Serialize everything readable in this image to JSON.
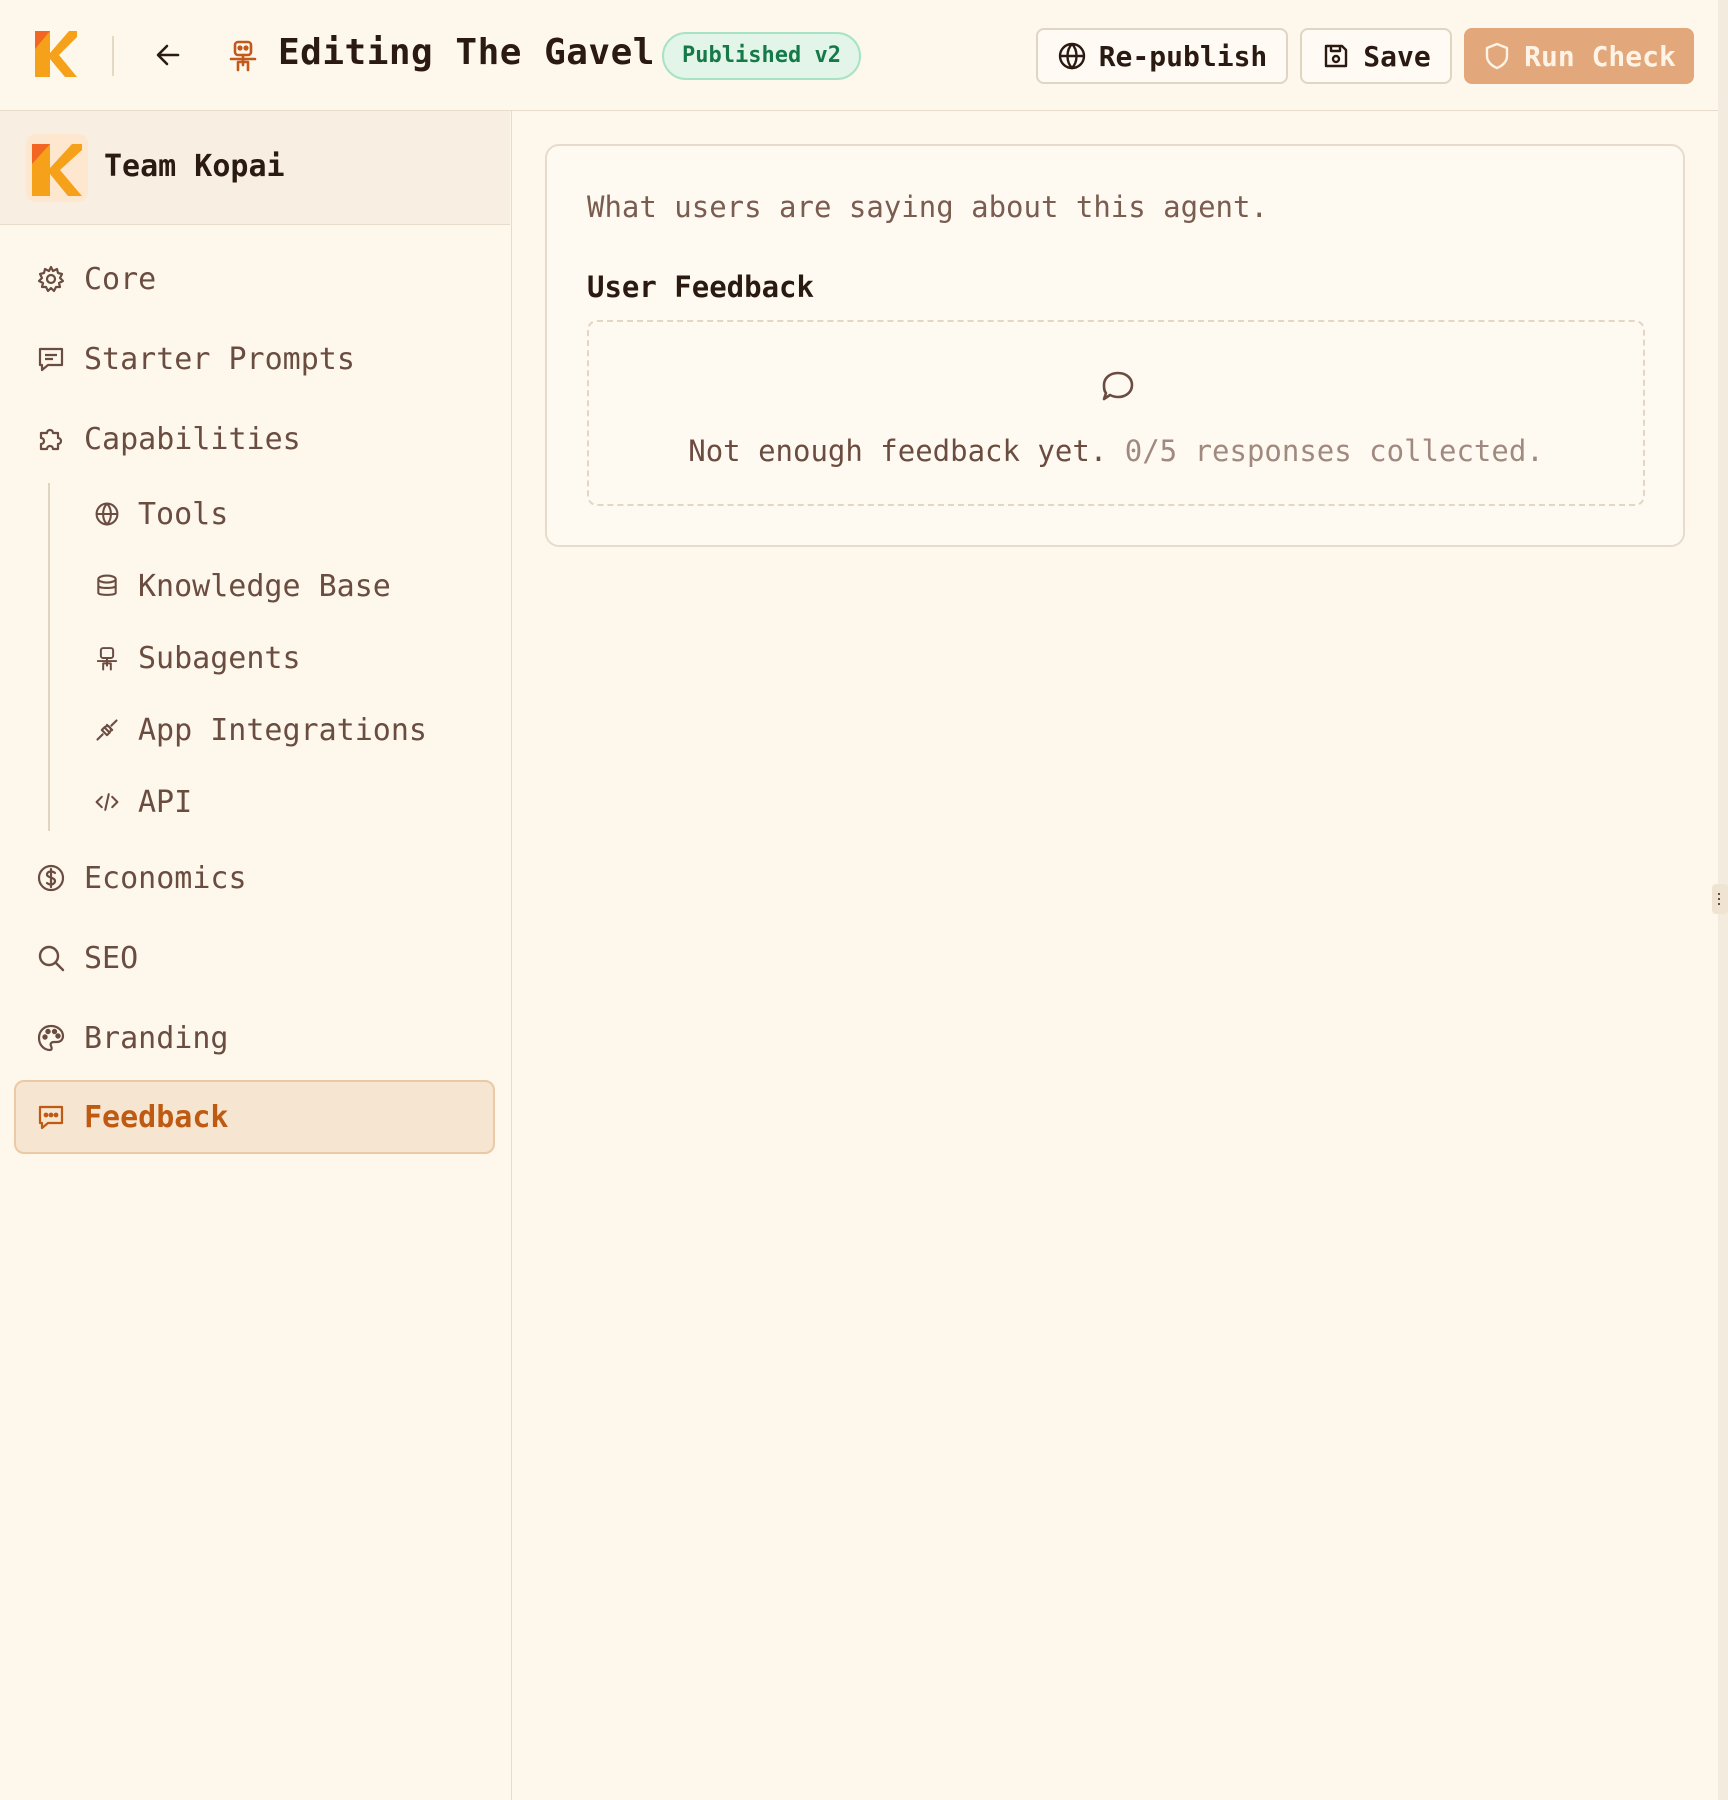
{
  "header": {
    "logo_icon": "kopai-logo-icon",
    "back_icon": "arrow-left-icon",
    "agent_icon": "robot-icon",
    "title": "Editing The Gavel",
    "badge": "Published v2",
    "buttons": {
      "republish": {
        "label": "Re-publish",
        "icon": "globe-icon"
      },
      "save": {
        "label": "Save",
        "icon": "floppy-icon"
      },
      "run_check": {
        "label": "Run Check",
        "icon": "shield-icon"
      }
    }
  },
  "sidebar": {
    "team": {
      "name": "Team Kopai",
      "logo_icon": "team-logo-icon"
    },
    "items": [
      {
        "label": "Core",
        "icon": "gear-icon"
      },
      {
        "label": "Starter Prompts",
        "icon": "message-square-icon"
      },
      {
        "label": "Capabilities",
        "icon": "puzzle-icon"
      },
      {
        "label": "Tools",
        "icon": "globe-icon"
      },
      {
        "label": "Knowledge Base",
        "icon": "database-icon"
      },
      {
        "label": "Subagents",
        "icon": "robot-icon"
      },
      {
        "label": "App Integrations",
        "icon": "plug-icon"
      },
      {
        "label": "API",
        "icon": "code-icon"
      },
      {
        "label": "Economics",
        "icon": "dollar-circle-icon"
      },
      {
        "label": "SEO",
        "icon": "search-icon"
      },
      {
        "label": "Branding",
        "icon": "palette-icon"
      },
      {
        "label": "Feedback",
        "icon": "message-dots-icon",
        "active": true
      }
    ]
  },
  "main": {
    "description": "What users are saying about this agent.",
    "heading": "User Feedback",
    "empty_state": {
      "icon": "chat-bubble-icon",
      "message": "Not enough feedback yet.",
      "count_text": "0/5 responses collected."
    }
  },
  "colors": {
    "background": "#fdf7ec",
    "accent": "#bf5a12",
    "run_button": "#e2a77a",
    "badge_bg": "#e2f5e8",
    "badge_text": "#16794a"
  }
}
